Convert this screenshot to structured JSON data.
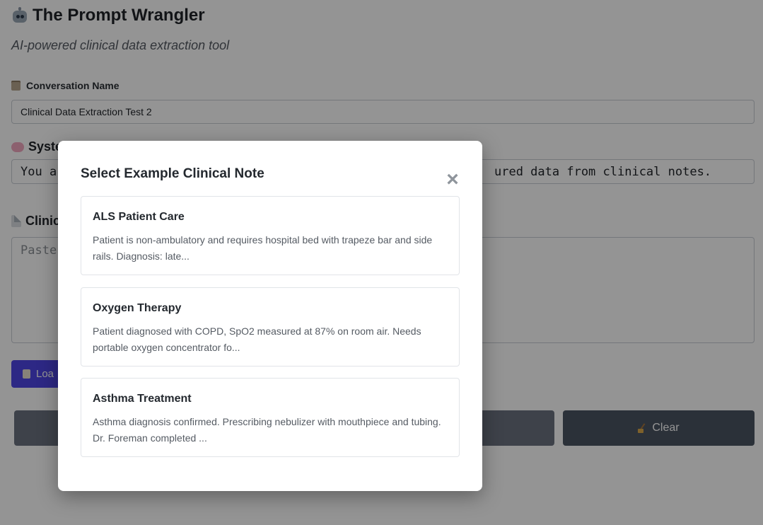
{
  "app": {
    "title": "The Prompt Wrangler",
    "subtitle": "AI-powered clinical data extraction tool"
  },
  "conversation": {
    "label": "Conversation Name",
    "value": "Clinical Data Extraction Test 2"
  },
  "system_prompt": {
    "title_visible": "Syste",
    "left_visible": "You ar",
    "right_visible": "ured data from clinical notes."
  },
  "clinical_note": {
    "title_visible": "Clinic",
    "placeholder_visible": "Paste"
  },
  "buttons": {
    "load_visible": "Loa",
    "clear": "Clear"
  },
  "modal": {
    "title": "Select Example Clinical Note",
    "close_symbol": "×",
    "notes": [
      {
        "title": "ALS Patient Care",
        "preview": "Patient is non-ambulatory and requires hospital bed with trapeze bar and side rails. Diagnosis: late..."
      },
      {
        "title": "Oxygen Therapy",
        "preview": "Patient diagnosed with COPD, SpO2 measured at 87% on room air. Needs portable oxygen concentrator fo..."
      },
      {
        "title": "Asthma Treatment",
        "preview": "Asthma diagnosis confirmed. Prescribing nebulizer with mouthpiece and tubing. Dr. Foreman completed ..."
      }
    ]
  },
  "icons": {
    "app": "robot-icon",
    "conversation": "notebook-icon",
    "system": "brain-icon",
    "clinical": "document-icon",
    "load": "clipboard-icon",
    "clear": "broom-icon",
    "close": "close-icon"
  },
  "colors": {
    "primary": "#4f46e5",
    "run_button": "#6b7280",
    "clear_button": "#4b5563",
    "overlay": "rgba(0,0,0,0.42)"
  }
}
